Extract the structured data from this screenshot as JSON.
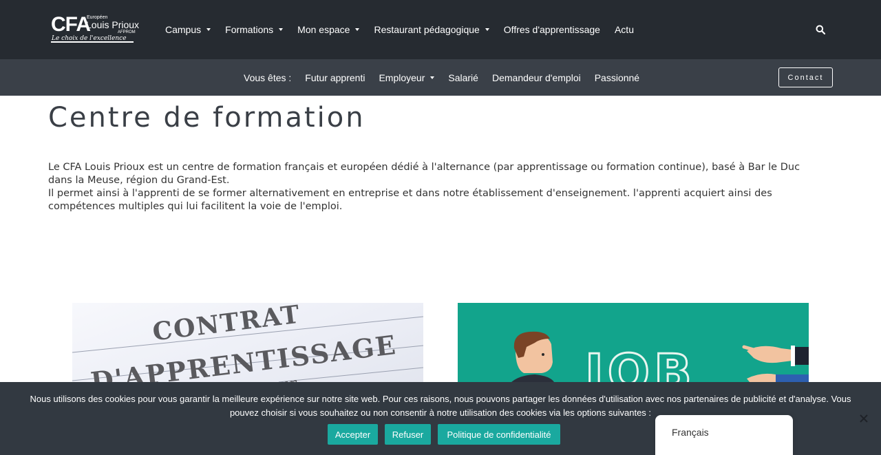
{
  "header": {
    "logo": {
      "brand": "CFA",
      "europeen": "Européen",
      "name": "Louis Prioux",
      "afprom": "AFPROM",
      "tagline": "Le choix de l'excellence"
    },
    "nav": [
      {
        "label": "Campus",
        "has_caret": true
      },
      {
        "label": "Formations",
        "has_caret": true
      },
      {
        "label": "Mon espace",
        "has_caret": true
      },
      {
        "label": "Restaurant pédagogique",
        "has_caret": true
      },
      {
        "label": "Offres d'apprentissage",
        "has_caret": false
      },
      {
        "label": "Actu",
        "has_caret": false
      }
    ],
    "search_icon": "search-icon"
  },
  "subnav": {
    "prefix": "Vous êtes :",
    "items": [
      {
        "label": "Futur apprenti",
        "has_caret": false
      },
      {
        "label": "Employeur",
        "has_caret": true
      },
      {
        "label": "Salarié",
        "has_caret": false
      },
      {
        "label": "Demandeur d'emploi",
        "has_caret": false
      },
      {
        "label": "Passionné",
        "has_caret": false
      }
    ],
    "contact_label": "Contact"
  },
  "main": {
    "title": "Centre de formation",
    "paragraph_1": "Le CFA Louis Prioux est un centre de formation français et européen dédié à l'alternance (par apprentissage ou formation continue), basé à Bar le Duc dans la Meuse, région du Grand-Est.",
    "paragraph_2": "Il permet ainsi à l'apprenti de se former alternativement en entreprise et dans notre établissement d'enseignement. l'apprenti acquiert ainsi des compétences multiples qui lui facilitent la voie de l'emploi.",
    "card_left": {
      "line1": "CONTRAT",
      "line2": "D'APPRENTISSAGE",
      "line3": "L'employeur"
    },
    "card_right": {
      "word": "JOB"
    }
  },
  "cookie": {
    "text": "Nous utilisons des cookies pour vous garantir la meilleure expérience sur notre site web. Pour ces raisons, nous pouvons partager les données d'utilisation avec nos partenaires de publicité et d'analyse. Vous pouvez choisir si vous souhaitez ou non consentir à notre utilisation des cookies via les options suivantes :",
    "accept_label": "Accepter",
    "refuse_label": "Refuser",
    "policy_label": "Politique de confidentialité",
    "close_icon": "close-icon"
  },
  "language": {
    "current": "Français"
  },
  "colors": {
    "header_bg": "#262b31",
    "subbar_bg": "#3a4048",
    "cookie_bg": "#323941",
    "button_accent": "#1aa99f",
    "job_bg": "#12a48c"
  }
}
